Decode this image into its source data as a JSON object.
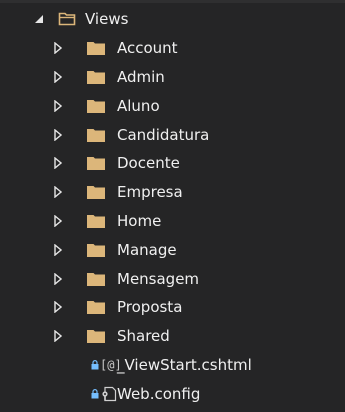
{
  "tree": {
    "root": {
      "label": "Views",
      "expanded": true
    },
    "children": [
      {
        "label": "Account"
      },
      {
        "label": "Admin"
      },
      {
        "label": "Aluno"
      },
      {
        "label": "Candidatura"
      },
      {
        "label": "Docente"
      },
      {
        "label": "Empresa"
      },
      {
        "label": "Home"
      },
      {
        "label": "Manage"
      },
      {
        "label": "Mensagem"
      },
      {
        "label": "Proposta"
      },
      {
        "label": "Shared"
      }
    ],
    "files": [
      {
        "label": "_ViewStart.cshtml",
        "icon": "razor-file-icon",
        "glyph": "[@]"
      },
      {
        "label": "Web.config",
        "icon": "config-file-icon"
      }
    ]
  },
  "colors": {
    "background": "#252526",
    "folder": "#dcb67a",
    "text": "#f0f0f0",
    "lock": "#75beff"
  }
}
